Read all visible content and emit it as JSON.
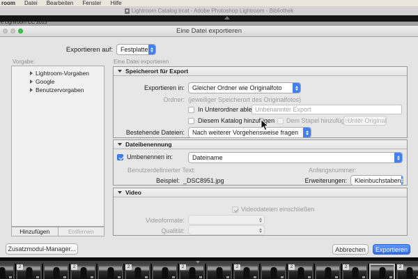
{
  "menu_bar": {
    "items": [
      {
        "label": "room"
      },
      {
        "label": "Datei"
      },
      {
        "label": "Bearbeiten"
      },
      {
        "label": "Fenster"
      },
      {
        "label": "Hilfe"
      }
    ]
  },
  "app_title_bar": {
    "title": "Lightroom Catalog.lrcat - Adobe Photoshop Lightroom - Bibliothek"
  },
  "window_partial_title": "e Lightroom CC 2015",
  "dialog": {
    "title": "Eine Datei exportieren",
    "export_to": {
      "label": "Exportieren auf:",
      "value": "Festplatte"
    },
    "sidebar": {
      "heading": "Vorgabe:",
      "items": [
        {
          "label": "Lightroom-Vorgaben"
        },
        {
          "label": "Google"
        },
        {
          "label": "Benutzervorgaben"
        }
      ],
      "add_button": "Hinzufügen",
      "remove_button": "Entfernen"
    },
    "main_heading": "Eine Datei exportieren",
    "panels": {
      "location": {
        "title": "Speicherort für Export",
        "export_in_label": "Exportieren in:",
        "export_in_value": "Gleicher Ordner wie Originalfoto",
        "folder_label": "Ordner:",
        "folder_value": "(jeweiliger Speicherort des Originalfotos)",
        "subfolder_label": "In Unterordner ablegen:",
        "subfolder_value": "Unbenannter Export",
        "add_to_catalog_label": "Diesem Katalog hinzufügen",
        "add_to_stack_label": "Dem Stapel hinzufügen:",
        "add_to_stack_value": "Unter Original",
        "existing_files_label": "Bestehende Dateien:",
        "existing_files_value": "Nach weiterer Vorgehensweise fragen"
      },
      "naming": {
        "title": "Dateibenennung",
        "rename_label": "Umbenennen in:",
        "rename_value": "Dateiname",
        "custom_text_label": "Benutzerdefinierter Text:",
        "start_number_label": "Anfangsnummer:",
        "example_label": "Beispiel:",
        "example_value": "_DSC8951.jpg",
        "extensions_label": "Erweiterungen:",
        "extensions_value": "Kleinbuchstaben"
      },
      "video": {
        "title": "Video",
        "include_label": "Videodateien einschließen",
        "formats_label": "Videoformate:",
        "quality_label": "Qualität:"
      }
    },
    "plugin_manager_button": "Zusatzmodul-Manager...",
    "cancel_button": "Abbrechen",
    "export_button": "Exportieren"
  },
  "filmstrip": {
    "badge_label": "2",
    "cell_count": 17,
    "badge_indices": [
      1,
      3,
      5,
      7,
      9,
      11,
      13,
      15
    ],
    "selected_index": 14
  },
  "colors": {
    "accent_blue": "#3f80f7",
    "export_button_blue": "#2f6ef0",
    "traffic_green": "#34c748"
  }
}
